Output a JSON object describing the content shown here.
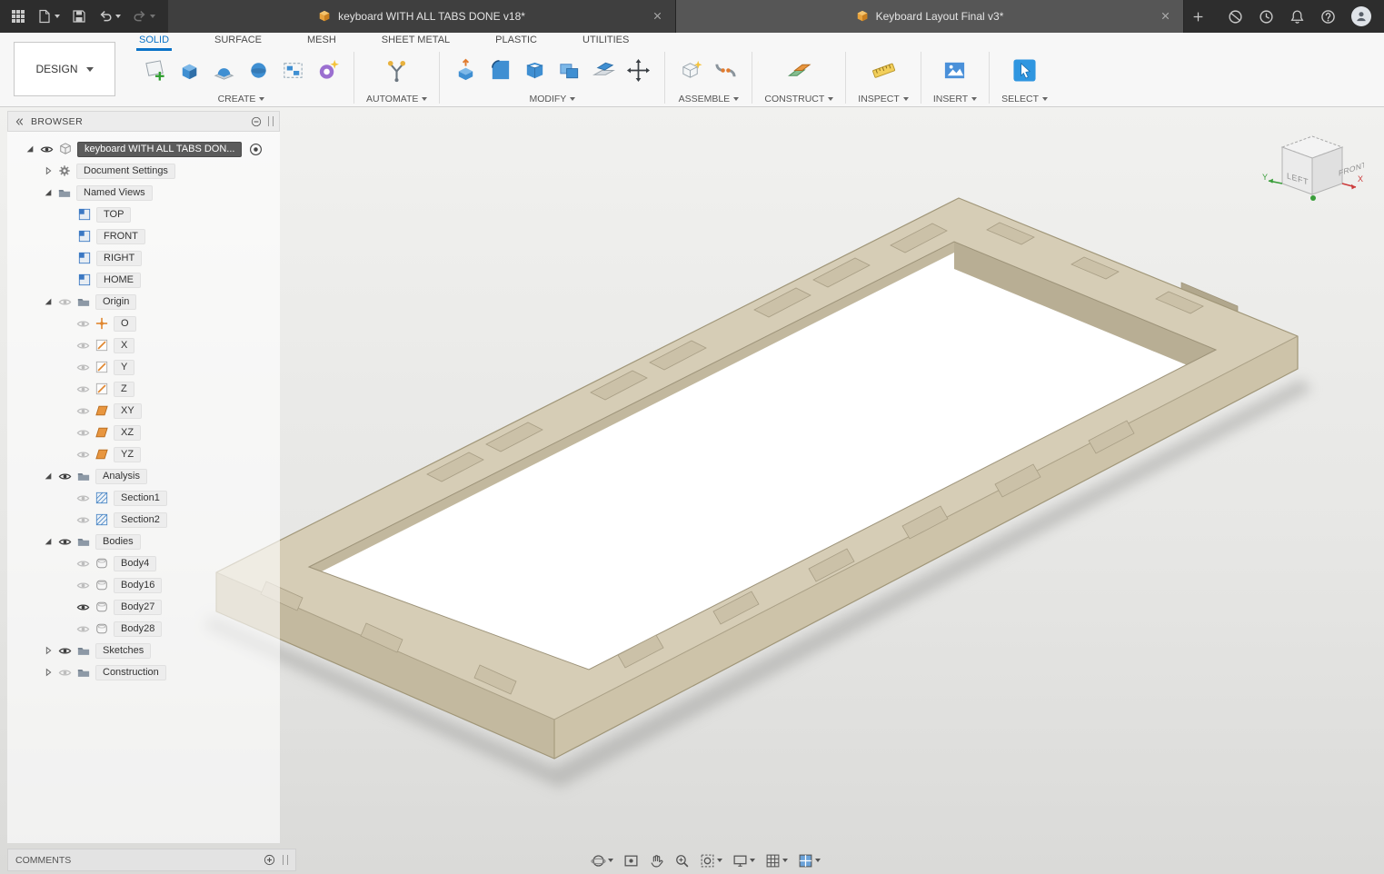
{
  "titlebar": {
    "tabs": [
      {
        "label": "keyboard WITH ALL TABS DONE v18*",
        "active": true
      },
      {
        "label": "Keyboard Layout Final v3*",
        "active": false
      }
    ]
  },
  "toolbar": {
    "workspace": "DESIGN",
    "ribbon_tabs": [
      "SOLID",
      "SURFACE",
      "MESH",
      "SHEET METAL",
      "PLASTIC",
      "UTILITIES"
    ],
    "active_ribbon_tab": "SOLID",
    "groups": [
      {
        "label": "CREATE"
      },
      {
        "label": "AUTOMATE"
      },
      {
        "label": "MODIFY"
      },
      {
        "label": "ASSEMBLE"
      },
      {
        "label": "CONSTRUCT"
      },
      {
        "label": "INSPECT"
      },
      {
        "label": "INSERT"
      },
      {
        "label": "SELECT"
      }
    ]
  },
  "browser": {
    "title": "BROWSER",
    "items": [
      {
        "label": "keyboard WITH ALL TABS DON...",
        "depth": 0,
        "type": "component",
        "eye": "on",
        "expander": "expanded",
        "selected": true
      },
      {
        "label": "Document Settings",
        "depth": 1,
        "type": "settings",
        "eye": "none",
        "expander": "collapsed"
      },
      {
        "label": "Named Views",
        "depth": 1,
        "type": "folder",
        "eye": "none",
        "expander": "expanded"
      },
      {
        "label": "TOP",
        "depth": 2,
        "type": "named-view",
        "eye": "none"
      },
      {
        "label": "FRONT",
        "depth": 2,
        "type": "named-view",
        "eye": "none"
      },
      {
        "label": "RIGHT",
        "depth": 2,
        "type": "named-view",
        "eye": "none"
      },
      {
        "label": "HOME",
        "depth": 2,
        "type": "named-view",
        "eye": "none"
      },
      {
        "label": "Origin",
        "depth": 1,
        "type": "folder",
        "eye": "off",
        "expander": "expanded"
      },
      {
        "label": "O",
        "depth": 2,
        "type": "origin-point",
        "eye": "off"
      },
      {
        "label": "X",
        "depth": 2,
        "type": "axis",
        "eye": "off"
      },
      {
        "label": "Y",
        "depth": 2,
        "type": "axis",
        "eye": "off"
      },
      {
        "label": "Z",
        "depth": 2,
        "type": "axis",
        "eye": "off"
      },
      {
        "label": "XY",
        "depth": 2,
        "type": "plane",
        "eye": "off"
      },
      {
        "label": "XZ",
        "depth": 2,
        "type": "plane",
        "eye": "off"
      },
      {
        "label": "YZ",
        "depth": 2,
        "type": "plane",
        "eye": "off"
      },
      {
        "label": "Analysis",
        "depth": 1,
        "type": "folder",
        "eye": "on",
        "expander": "expanded"
      },
      {
        "label": "Section1",
        "depth": 2,
        "type": "section",
        "eye": "off"
      },
      {
        "label": "Section2",
        "depth": 2,
        "type": "section",
        "eye": "off"
      },
      {
        "label": "Bodies",
        "depth": 1,
        "type": "folder",
        "eye": "on",
        "expander": "expanded"
      },
      {
        "label": "Body4",
        "depth": 2,
        "type": "body",
        "eye": "off"
      },
      {
        "label": "Body16",
        "depth": 2,
        "type": "body",
        "eye": "off"
      },
      {
        "label": "Body27",
        "depth": 2,
        "type": "body",
        "eye": "on"
      },
      {
        "label": "Body28",
        "depth": 2,
        "type": "body",
        "eye": "off"
      },
      {
        "label": "Sketches",
        "depth": 1,
        "type": "folder",
        "eye": "on",
        "expander": "collapsed"
      },
      {
        "label": "Construction",
        "depth": 1,
        "type": "folder",
        "eye": "off",
        "expander": "collapsed"
      }
    ]
  },
  "viewcube": {
    "faces": {
      "left": "LEFT",
      "front": "FRONT"
    },
    "axes": {
      "x": "X",
      "y": "Y"
    }
  },
  "comments": {
    "label": "COMMENTS"
  },
  "colors": {
    "accent": "#0a72c7",
    "model_top": "#d6cdb6",
    "model_wall": "#c3b99f",
    "canvas": "#e7e7e5"
  }
}
